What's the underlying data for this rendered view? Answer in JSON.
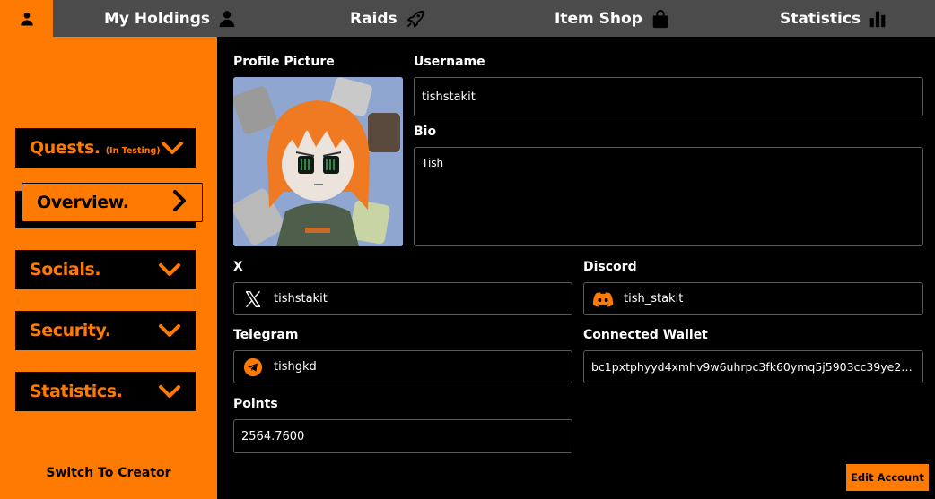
{
  "colors": {
    "accent": "#ff7a00",
    "nav_bg": "#4b4b4b",
    "panel_bg": "#000000",
    "field_border": "#5a5a5a"
  },
  "nav": {
    "profile_icon": "user-icon",
    "items": [
      {
        "label": "My Holdings",
        "icon": "user-icon"
      },
      {
        "label": "Raids",
        "icon": "rocket-icon"
      },
      {
        "label": "Item Shop",
        "icon": "shopping-bag-icon"
      },
      {
        "label": "Statistics",
        "icon": "bar-chart-icon"
      }
    ]
  },
  "sidebar": {
    "quests": {
      "label": "Quests.",
      "tag": "(In Testing)"
    },
    "overview": {
      "label": "Overview."
    },
    "socials": {
      "label": "Socials."
    },
    "security": {
      "label": "Security."
    },
    "statistics": {
      "label": "Statistics."
    },
    "switch_label": "Switch To Creator"
  },
  "profile": {
    "picture_label": "Profile Picture",
    "username_label": "Username",
    "username": "tishstakit",
    "bio_label": "Bio",
    "bio": "Tish",
    "x_label": "X",
    "x": "tishstakit",
    "discord_label": "Discord",
    "discord": "tish_stakit",
    "telegram_label": "Telegram",
    "telegram": "tishgkd",
    "wallet_label": "Connected Wallet",
    "wallet": "bc1pxtphyyd4xmhv9w6uhrpc3fk60ymq5j5903cc39ye2aqjs…",
    "points_label": "Points",
    "points": "2564.7600"
  },
  "actions": {
    "edit_label": "Edit Account"
  }
}
